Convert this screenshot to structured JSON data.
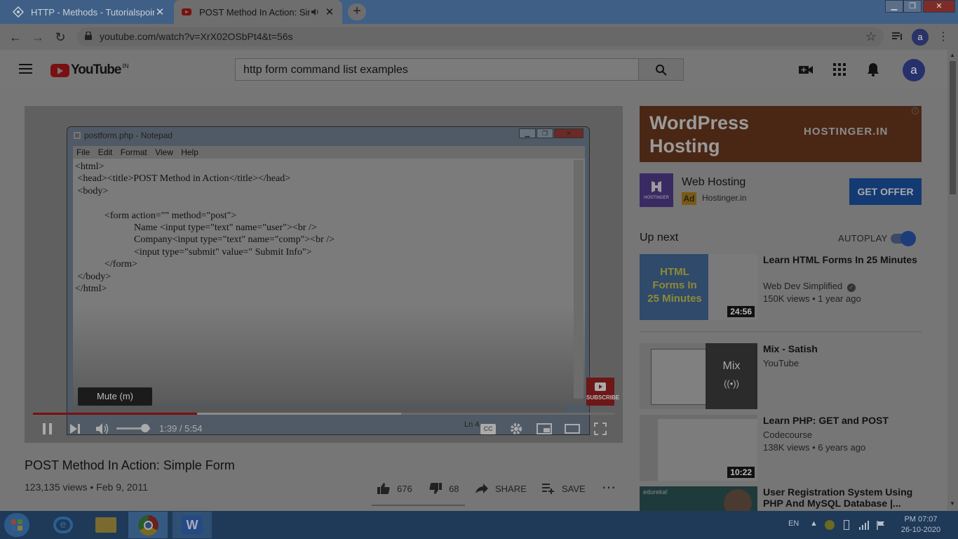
{
  "browser": {
    "tabs": [
      {
        "title": "HTTP - Methods - Tutorialspoint",
        "active": false
      },
      {
        "title": "POST Method In Action: Simp",
        "active": true
      }
    ],
    "url": "youtube.com/watch?v=XrX02OSbPt4&t=56s"
  },
  "youtube": {
    "region": "IN",
    "search_query": "http form command list examples",
    "avatar_letter": "a"
  },
  "player": {
    "notepad_title": "postform.php - Notepad",
    "menu": [
      "File",
      "Edit",
      "Format",
      "View",
      "Help"
    ],
    "code": "<html>\n <head><title>POST Method in Action</title></head>\n <body>\n\n            <form action=\"\" method=\"post\">\n                        Name <input type=\"text\" name=\"user\"><br />\n                        Company<input type=\"text\" name=\"comp\"><br />\n                        <input type=\"submit\" value=\" Submit Info\">\n            </form>\n </body>\n</html>",
    "status_text": "Ln 4,",
    "tooltip": "Mute (m)",
    "subscribe_label": "SUBSCRIBE",
    "time": "1:39 / 5:54",
    "progress_played_fraction": 0.282,
    "progress_buffered_fraction": 0.633,
    "volume_fraction": 0.85
  },
  "video": {
    "title": "POST Method In Action: Simple Form",
    "meta": "123,135 views • Feb 9, 2011",
    "likes": "676",
    "dislikes": "68",
    "share_label": "SHARE",
    "save_label": "SAVE"
  },
  "ad": {
    "banner_text": "WordPress\nHosting",
    "banner_brand": "HOSTINGER.IN",
    "title": "Web Hosting",
    "badge": "Ad",
    "site": "Hostinger.in",
    "cta": "GET OFFER",
    "logo_text": "HOSTINGER"
  },
  "sidebar": {
    "up_next": "Up next",
    "autoplay": "AUTOPLAY",
    "recommendations": [
      {
        "title": "Learn HTML Forms In 25 Minutes",
        "channel": "Web Dev Simplified",
        "views": "150K views • 1 year ago",
        "duration": "24:56",
        "thumb_text": "HTML Forms In 25 Minutes"
      },
      {
        "title": "Mix - Satish",
        "channel": "YouTube",
        "views": "",
        "duration": "",
        "thumb_text": "Mix"
      },
      {
        "title": "Learn PHP: GET and POST",
        "channel": "Codecourse",
        "views": "138K views • 6 years ago",
        "duration": "10:22",
        "thumb_text": ""
      },
      {
        "title": "User Registration System Using PHP And MySQL Database |...",
        "channel": "",
        "views": "",
        "duration": "",
        "thumb_text": "edureka!"
      }
    ]
  },
  "taskbar": {
    "lang": "EN",
    "time": "PM 07:07",
    "date": "26-10-2020"
  }
}
